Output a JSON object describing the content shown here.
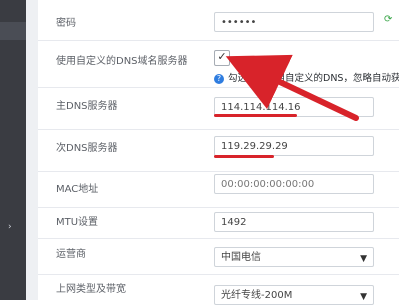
{
  "fields": {
    "password": {
      "label": "密码",
      "value": "••••••"
    },
    "custom_dns": {
      "label": "使用自定义的DNS域名服务器",
      "checked": true,
      "hint": "勾选，将使用自定义的DNS，忽略自动获取"
    },
    "primary_dns": {
      "label": "主DNS服务器",
      "value": "114.114.114.16"
    },
    "secondary_dns": {
      "label": "次DNS服务器",
      "value": "119.29.29.29"
    },
    "mac": {
      "label": "MAC地址",
      "placeholder": "00:00:00:00:00:00"
    },
    "mtu": {
      "label": "MTU设置",
      "value": "1492"
    },
    "isp": {
      "label": "运营商",
      "selected": "中国电信"
    },
    "access": {
      "label": "上网类型及带宽",
      "selected": "光纤专线-200M"
    }
  },
  "icons": {
    "refresh": "refresh-icon",
    "check": "check-icon",
    "help": "help-icon"
  },
  "colors": {
    "accent_red": "#d8232a",
    "hint_blue": "#2f7de0",
    "refresh_green": "#3aa649",
    "sidebar": "#3a3c42"
  }
}
